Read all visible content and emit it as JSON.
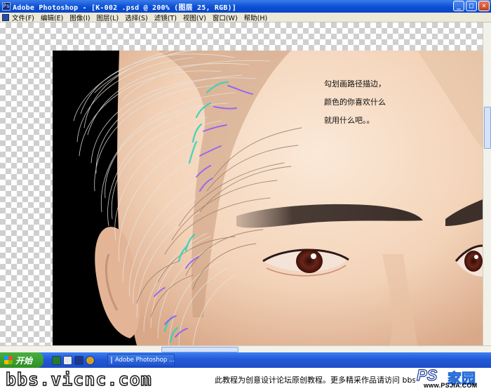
{
  "window": {
    "title": "Adobe Photoshop - [K-002 .psd @ 200% (图层 25, RGB)]"
  },
  "menu": [
    "文件(F)",
    "编辑(E)",
    "图像(I)",
    "图层(L)",
    "选择(S)",
    "滤镜(T)",
    "视图(V)",
    "窗口(W)",
    "帮助(H)"
  ],
  "annotation": {
    "line1": "勾划画路径描边，",
    "line2": "颜色的你喜欢什么",
    "line3": "就用什么吧。。"
  },
  "taskbar": {
    "start_label": "开始",
    "task_label": "Adobe Photoshop ..."
  },
  "footer": {
    "site": "bbs.vicnc.com",
    "note": "此教程为创意设计论坛原创教程。更多精采作品请访问 bbs.vicnc.com",
    "logo_ps": "PS",
    "logo_cn": "家园",
    "logo_url": "www.PSJIA.COM"
  },
  "colors": {
    "titlebar": "#0a4fd6",
    "start": "#2f8f26",
    "skin": "#f1d1b5",
    "path_stroke_cyan": "#2fd3b8",
    "path_stroke_purple": "#8a5cff"
  }
}
